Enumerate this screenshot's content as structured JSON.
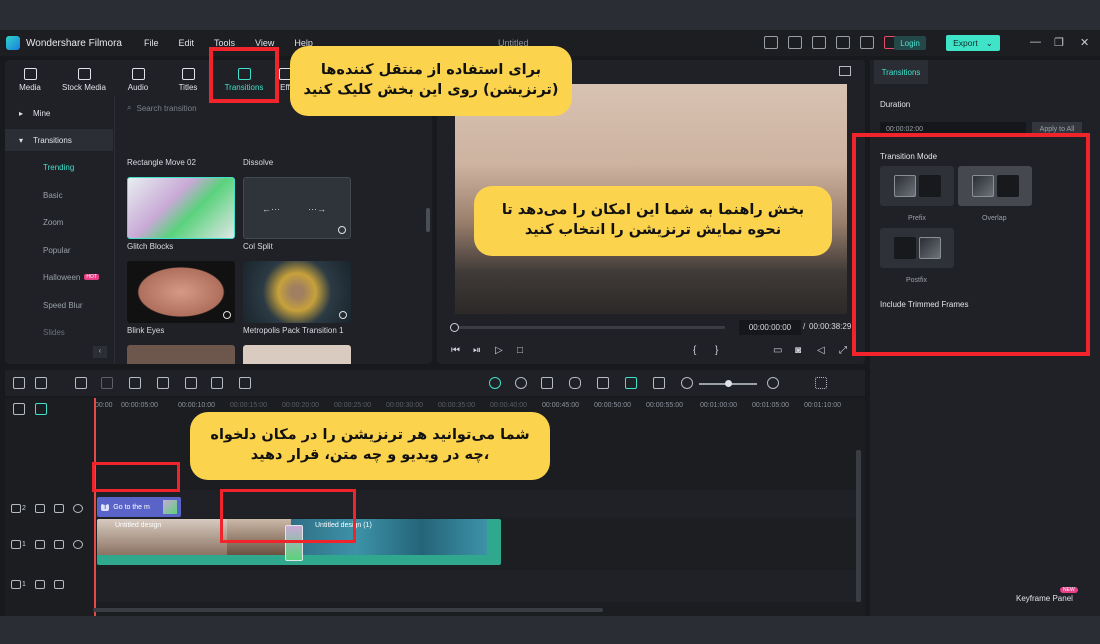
{
  "app": {
    "name": "Wondershare Filmora",
    "menu": [
      "File",
      "Edit",
      "Tools",
      "View",
      "Help"
    ],
    "doc_title": "Untitled",
    "login": "Login",
    "export": "Export"
  },
  "library": {
    "tabs": [
      "Media",
      "Stock Media",
      "Audio",
      "Titles",
      "Transitions",
      "Eff"
    ],
    "active_tab": "Transitions",
    "sidebar": {
      "mine": "Mine",
      "transitions": "Transitions",
      "items": [
        "Trending",
        "Basic",
        "Zoom",
        "Popular",
        "Halloween",
        "Speed Blur",
        "Slides"
      ],
      "hot_badge": "HOT"
    },
    "search_placeholder": "Search transition",
    "section_labels": [
      "Rectangle Move 02",
      "Dissolve"
    ],
    "thumbs": [
      "Glitch Blocks",
      "Col Split",
      "Blink Eyes",
      "Metropolis Pack Transition 1"
    ]
  },
  "player": {
    "current_time": "00:00:00:00",
    "separator": "/",
    "total_time": "00:00:38:29"
  },
  "properties": {
    "tab": "Transitions",
    "duration_label": "Duration",
    "duration_value": "00:00:02:00",
    "apply_all": "Apply to All",
    "mode_label": "Transition Mode",
    "modes": [
      "Prefix",
      "Overlap",
      "Postfix"
    ],
    "include_trimmed": "Include Trimmed Frames",
    "keyframe_panel": "Keyframe Panel",
    "new_badge": "NEW"
  },
  "timeline": {
    "ruler": [
      "00:00",
      "00:00:05:00",
      "00:00:10:00",
      "00:00:15:00",
      "00:00:20:00",
      "00:00:25:00",
      "00:00:30:00",
      "00:00:35:00",
      "00:00:40:00",
      "00:00:45:00",
      "00:00:50:00",
      "00:00:55:00",
      "00:01:00:00",
      "00:01:05:00",
      "00:01:10:00"
    ],
    "tracks": [
      "2",
      "1",
      "1"
    ],
    "title_clip": "Go to the m",
    "video_clip_a": "Untitled design",
    "video_clip_b": "Untitled design (1)"
  },
  "annotations": {
    "transitions_tip_line1": "برای استفاده از منتقل کننده‌ها",
    "transitions_tip_line2": "(ترنزیشن) روی این بخش کلیک کنید",
    "mode_tip_line1": "بخش راهنما به شما این امکان را می‌دهد تا",
    "mode_tip_line2": "نحوه نمایش ترنزیشن را انتخاب کنید",
    "timeline_tip_line1": "شما می‌توانید هر ترنزیشن را در مکان دلخواه",
    "timeline_tip_line2": "،چه در ویدیو و چه متن، قرار دهید"
  },
  "colors": {
    "accent": "#41e0cc",
    "annotation_box": "#f0242a",
    "bubble": "#fcd34d"
  }
}
